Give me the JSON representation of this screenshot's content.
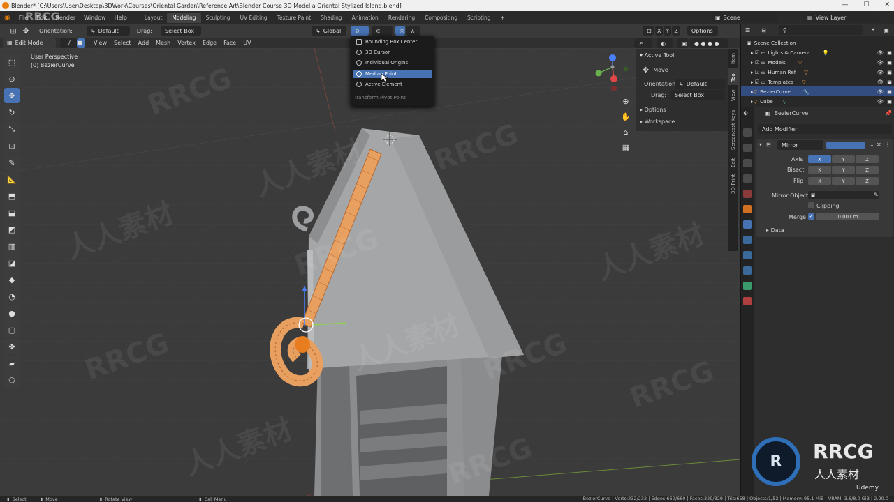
{
  "window": {
    "title": "Blender* [C:\\Users\\User\\Desktop\\3DWork\\Courses\\Oriental Garden\\Reference Art\\Blender Course 3D Model a Oriental Stylized Island.blend]",
    "controls": [
      "—",
      "☐",
      "✕"
    ]
  },
  "menu": {
    "items": [
      "File",
      "Edit",
      "Render",
      "Window",
      "Help"
    ],
    "workspaces": [
      "Layout",
      "Modeling",
      "Sculpting",
      "UV Editing",
      "Texture Paint",
      "Shading",
      "Animation",
      "Rendering",
      "Compositing",
      "Scripting"
    ],
    "active_workspace": "Modeling",
    "add_tab": "+",
    "scene_label": "Scene",
    "view_layer_label": "View Layer"
  },
  "tool_header": {
    "orientation_label": "Orientation:",
    "orientation_value": "Default",
    "drag_label": "Drag:",
    "drag_value": "Select Box",
    "transform_orientation": "Global",
    "axes": [
      "X",
      "Y",
      "Z"
    ],
    "options": "Options"
  },
  "mode_header": {
    "mode": "Edit Mode",
    "menus": [
      "View",
      "Select",
      "Add",
      "Mesh",
      "Vertex",
      "Edge",
      "Face",
      "UV"
    ]
  },
  "viewport": {
    "perspective": "User Perspective",
    "object": "(0) BezierCurve"
  },
  "pivot_menu": {
    "items": [
      "Bounding Box Center",
      "3D Cursor",
      "Individual Origins",
      "Median Point",
      "Active Element"
    ],
    "highlighted": "Median Point",
    "footer": "Transform Pivot Point"
  },
  "n_panel": {
    "section": "Active Tool",
    "tool": "Move",
    "orientation_label": "Orientation",
    "orientation_value": "Default",
    "drag_label": "Drag:",
    "drag_value": "Select Box",
    "options": "Options",
    "workspace": "Workspace",
    "tabs": [
      "Item",
      "Tool",
      "View",
      "Screencast Keys",
      "Edit",
      "3D-Print"
    ]
  },
  "outliner": {
    "root": "Scene Collection",
    "items": [
      {
        "name": "Lights & Camera"
      },
      {
        "name": "Models"
      },
      {
        "name": "Human Ref"
      },
      {
        "name": "Templates"
      },
      {
        "name": "BezierCurve"
      },
      {
        "name": "Cube"
      }
    ],
    "selected": "BezierCurve"
  },
  "properties": {
    "object": "BezierCurve",
    "add_modifier": "Add Modifier",
    "modifier_name": "Mirror",
    "axis_label": "Axis",
    "bisect_label": "Bisect",
    "flip_label": "Flip",
    "xyz": [
      "X",
      "Y",
      "Z"
    ],
    "mirror_object_label": "Mirror Object",
    "clipping_label": "Clipping",
    "merge_label": "Merge",
    "merge_value": "0.001 m",
    "data_label": "Data"
  },
  "statusbar": {
    "left": [
      "Select",
      "Move",
      "Rotate View",
      "Call Menu"
    ],
    "right": "BezierCurve | Verts:232/232 | Edges:660/660 | Faces:329/329 | Tris:658 | Objects:1/52 | Memory: 95.1 MiB | VRAM: 3.6/8.0 GiB | 2.90.0"
  },
  "watermarks": [
    "RRCG",
    "人人素材"
  ],
  "logo": {
    "main": "RRCG",
    "sub": "人人素材",
    "udemy": "Udemy"
  },
  "colors": {
    "accent": "#4772b3",
    "selection_orange": "#e8a060",
    "blender_orange": "#e87d0d"
  }
}
